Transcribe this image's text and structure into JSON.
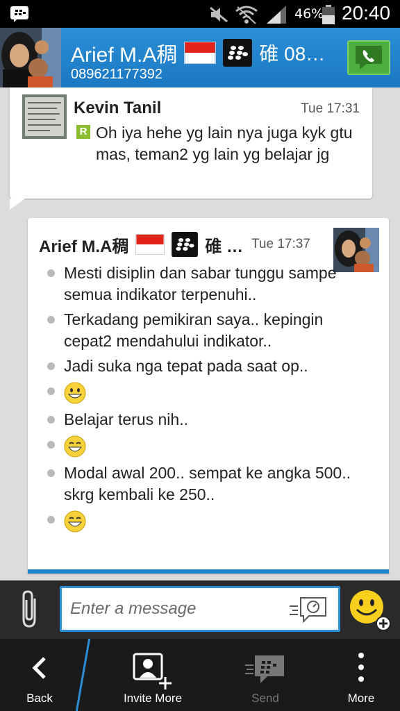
{
  "status_bar": {
    "battery_percent": "46%",
    "time": "20:40",
    "icons": [
      "bbm-notification-icon",
      "mute-icon",
      "wifi-icon",
      "signal-icon",
      "battery-icon"
    ]
  },
  "header": {
    "contact_name": "Arief M.A稠",
    "pin_text": "碓 08…",
    "phone": "089621177392",
    "call_icon": "phone-call-icon"
  },
  "messages": [
    {
      "sender": "Kevin Tanil",
      "time": "Tue 17:31",
      "status": "R",
      "text": "Oh iya hehe yg lain nya juga kyk gtu mas, teman2 yg lain yg belajar jg"
    },
    {
      "sender": "Arief M.A稠",
      "pin_text": "碓 …",
      "time": "Tue 17:37",
      "items": [
        "Mesti disiplin dan sabar tunggu sampe semua indikator terpenuhi..",
        "Terkadang pemikiran saya.. kepingin cepat2 mendahului indikator..",
        "Jadi suka nga tepat pada saat op..",
        "",
        "Belajar terus nih..",
        "",
        "Modal awal 200.. sempat ke angka 500.. skrg kembali ke 250..",
        ""
      ]
    }
  ],
  "compose": {
    "placeholder": "Enter a message"
  },
  "nav": {
    "back": "Back",
    "invite": "Invite More",
    "send": "Send",
    "more": "More"
  },
  "colors": {
    "header_blue": "#1b78c2",
    "accent_blue": "#2a8fd6",
    "call_green": "#4cae3c",
    "read_green": "#8cbd2e"
  }
}
